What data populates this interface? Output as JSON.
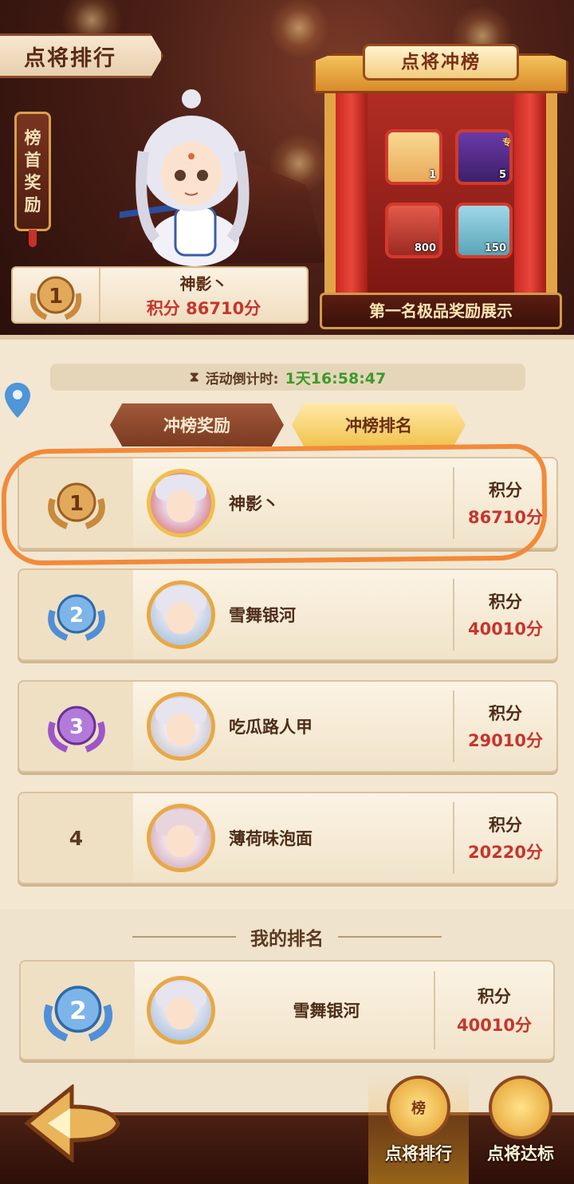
{
  "banner": {
    "title": "点将排行",
    "first_reward_label": [
      "榜",
      "首",
      "奖",
      "励"
    ],
    "top_player": {
      "rank": "1",
      "name": "神影丶",
      "score_text": "积分 86710分"
    }
  },
  "showcase": {
    "title": "点将冲榜",
    "items": [
      {
        "icon": "gold-ingot-icon",
        "count": "1",
        "tag": ""
      },
      {
        "icon": "purple-beast-icon",
        "count": "5",
        "tag": "专"
      },
      {
        "icon": "hero-portrait-icon",
        "count": "800",
        "tag": ""
      },
      {
        "icon": "dragon-icon",
        "count": "150",
        "tag": ""
      }
    ],
    "caption": "第一名极品奖励展示"
  },
  "countdown": {
    "label": "活动倒计时:",
    "value": "1天16:58:47"
  },
  "tabs": [
    {
      "label": "冲榜奖励",
      "active": false
    },
    {
      "label": "冲榜排名",
      "active": true
    }
  ],
  "ranking": [
    {
      "rank": "1",
      "name": "神影丶",
      "score_label": "积分",
      "score": "86710分",
      "medal_color": "#c98a3c"
    },
    {
      "rank": "2",
      "name": "雪舞银河",
      "score_label": "积分",
      "score": "40010分",
      "medal_color": "#4f8fd8"
    },
    {
      "rank": "3",
      "name": "吃瓜路人甲",
      "score_label": "积分",
      "score": "29010分",
      "medal_color": "#9b57c9"
    },
    {
      "rank": "4",
      "name": "薄荷味泡面",
      "score_label": "积分",
      "score": "20220分",
      "medal_color": ""
    }
  ],
  "my_ranking": {
    "title": "我的排名",
    "rank": "2",
    "name": "雪舞银河",
    "score_label": "积分",
    "score": "40010分"
  },
  "bottom_nav": {
    "items": [
      {
        "label": "点将排行",
        "icon_text": "榜",
        "active": true
      },
      {
        "label": "点将达标",
        "icon_text": "",
        "active": false
      }
    ]
  },
  "colors": {
    "score_red": "#c5362d",
    "countdown_green": "#3e9a2b",
    "highlight_orange": "#f28a3a"
  }
}
